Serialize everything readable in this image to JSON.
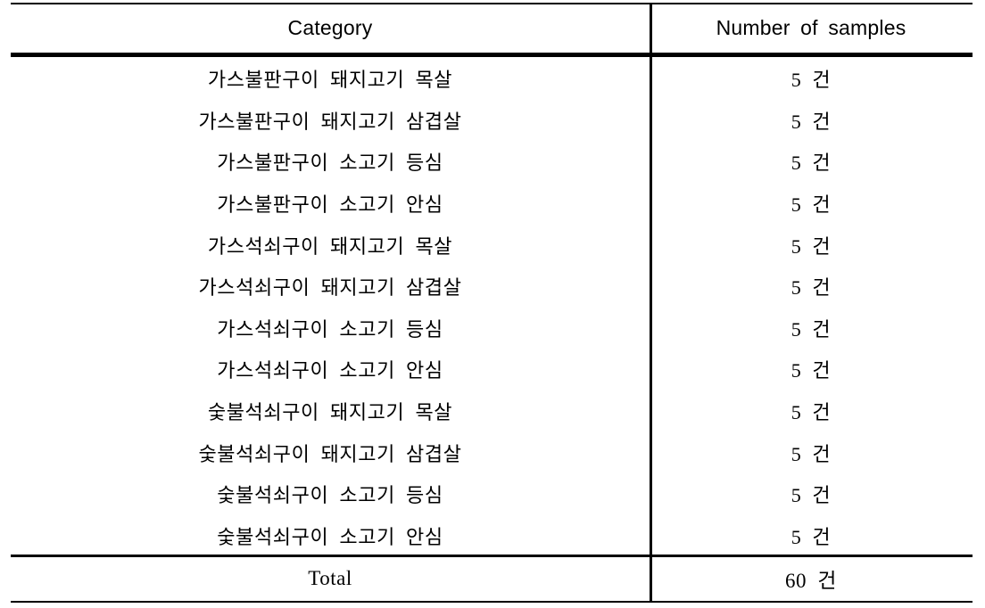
{
  "table": {
    "headers": {
      "category": "Category",
      "count": "Number of samples"
    },
    "rows": [
      {
        "category": "가스불판구이 돼지고기 목살",
        "count": "5 건"
      },
      {
        "category": "가스불판구이 돼지고기 삼겹살",
        "count": "5 건"
      },
      {
        "category": "가스불판구이 소고기 등심",
        "count": "5 건"
      },
      {
        "category": "가스불판구이 소고기 안심",
        "count": "5 건"
      },
      {
        "category": "가스석쇠구이 돼지고기 목살",
        "count": "5 건"
      },
      {
        "category": "가스석쇠구이 돼지고기 삼겹살",
        "count": "5 건"
      },
      {
        "category": "가스석쇠구이 소고기 등심",
        "count": "5 건"
      },
      {
        "category": "가스석쇠구이 소고기 안심",
        "count": "5 건"
      },
      {
        "category": "숯불석쇠구이 돼지고기 목살",
        "count": "5 건"
      },
      {
        "category": "숯불석쇠구이 돼지고기 삼겹살",
        "count": "5 건"
      },
      {
        "category": "숯불석쇠구이 소고기 등심",
        "count": "5 건"
      },
      {
        "category": "숯불석쇠구이 소고기 안심",
        "count": "5 건"
      }
    ],
    "total": {
      "label": "Total",
      "count": "60 건"
    }
  }
}
